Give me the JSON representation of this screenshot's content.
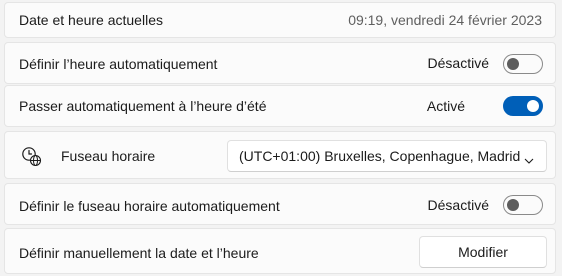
{
  "current_datetime": {
    "label": "Date et heure actuelles",
    "value": "09:19, vendredi 24 février 2023"
  },
  "auto_time": {
    "label": "Définir l’heure automatiquement",
    "status": "Désactivé",
    "enabled": false
  },
  "dst": {
    "label": "Passer automatiquement à l’heure d’été",
    "status": "Activé",
    "enabled": true
  },
  "timezone": {
    "label": "Fuseau horaire",
    "icon": "clock-globe-icon",
    "selected": "(UTC+01:00) Bruxelles, Copenhague, Madrid"
  },
  "auto_timezone": {
    "label": "Définir le fuseau horaire automatiquement",
    "status": "Désactivé",
    "enabled": false
  },
  "manual": {
    "label": "Définir manuellement la date et l’heure",
    "button": "Modifier"
  },
  "colors": {
    "accent": "#005fb8",
    "background": "#f3f3f3",
    "card": "#fbfbfb"
  }
}
